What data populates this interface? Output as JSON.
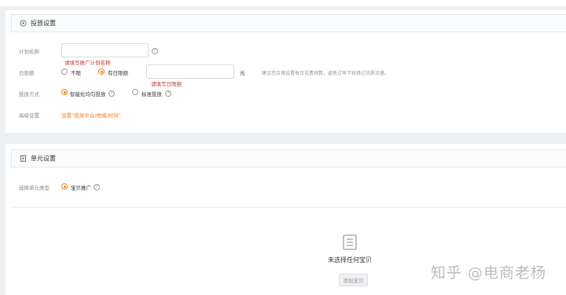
{
  "section1": {
    "title": "投放设置",
    "icon": "settings-target-icon",
    "plan_name": {
      "label": "计划名称",
      "value": "",
      "placeholder": "",
      "error": "请填写推广计划名称"
    },
    "daily_budget": {
      "label": "日限额",
      "options": [
        {
          "label": "不限",
          "selected": false
        },
        {
          "label": "有日限额",
          "selected": true
        }
      ],
      "value": "",
      "placeholder": "",
      "unit": "元",
      "error": "请填写日限额",
      "hint": "建议您合理设置每日花费预算，避免过早下线错过优质流量。"
    },
    "delivery_method": {
      "label": "投放方式",
      "options": [
        {
          "label": "智能化均匀投放",
          "selected": true
        },
        {
          "label": "标准投放",
          "selected": false
        }
      ]
    },
    "advanced": {
      "label": "高级设置",
      "link": "设置“投放平台/地域/时间”"
    }
  },
  "section2": {
    "title": "单元设置",
    "icon": "document-icon",
    "unit_type": {
      "label": "选择单元类型",
      "options": [
        {
          "label": "宝贝推广",
          "selected": true
        }
      ]
    },
    "empty": {
      "text": "未选择任何宝贝",
      "button": "添加宝贝",
      "icon": "list-document-icon"
    }
  },
  "help_glyph": "?",
  "watermark": "知乎 @电商老杨",
  "colors": {
    "accent": "#f57e15",
    "error": "#c0392b",
    "background": "#edf0f3"
  }
}
